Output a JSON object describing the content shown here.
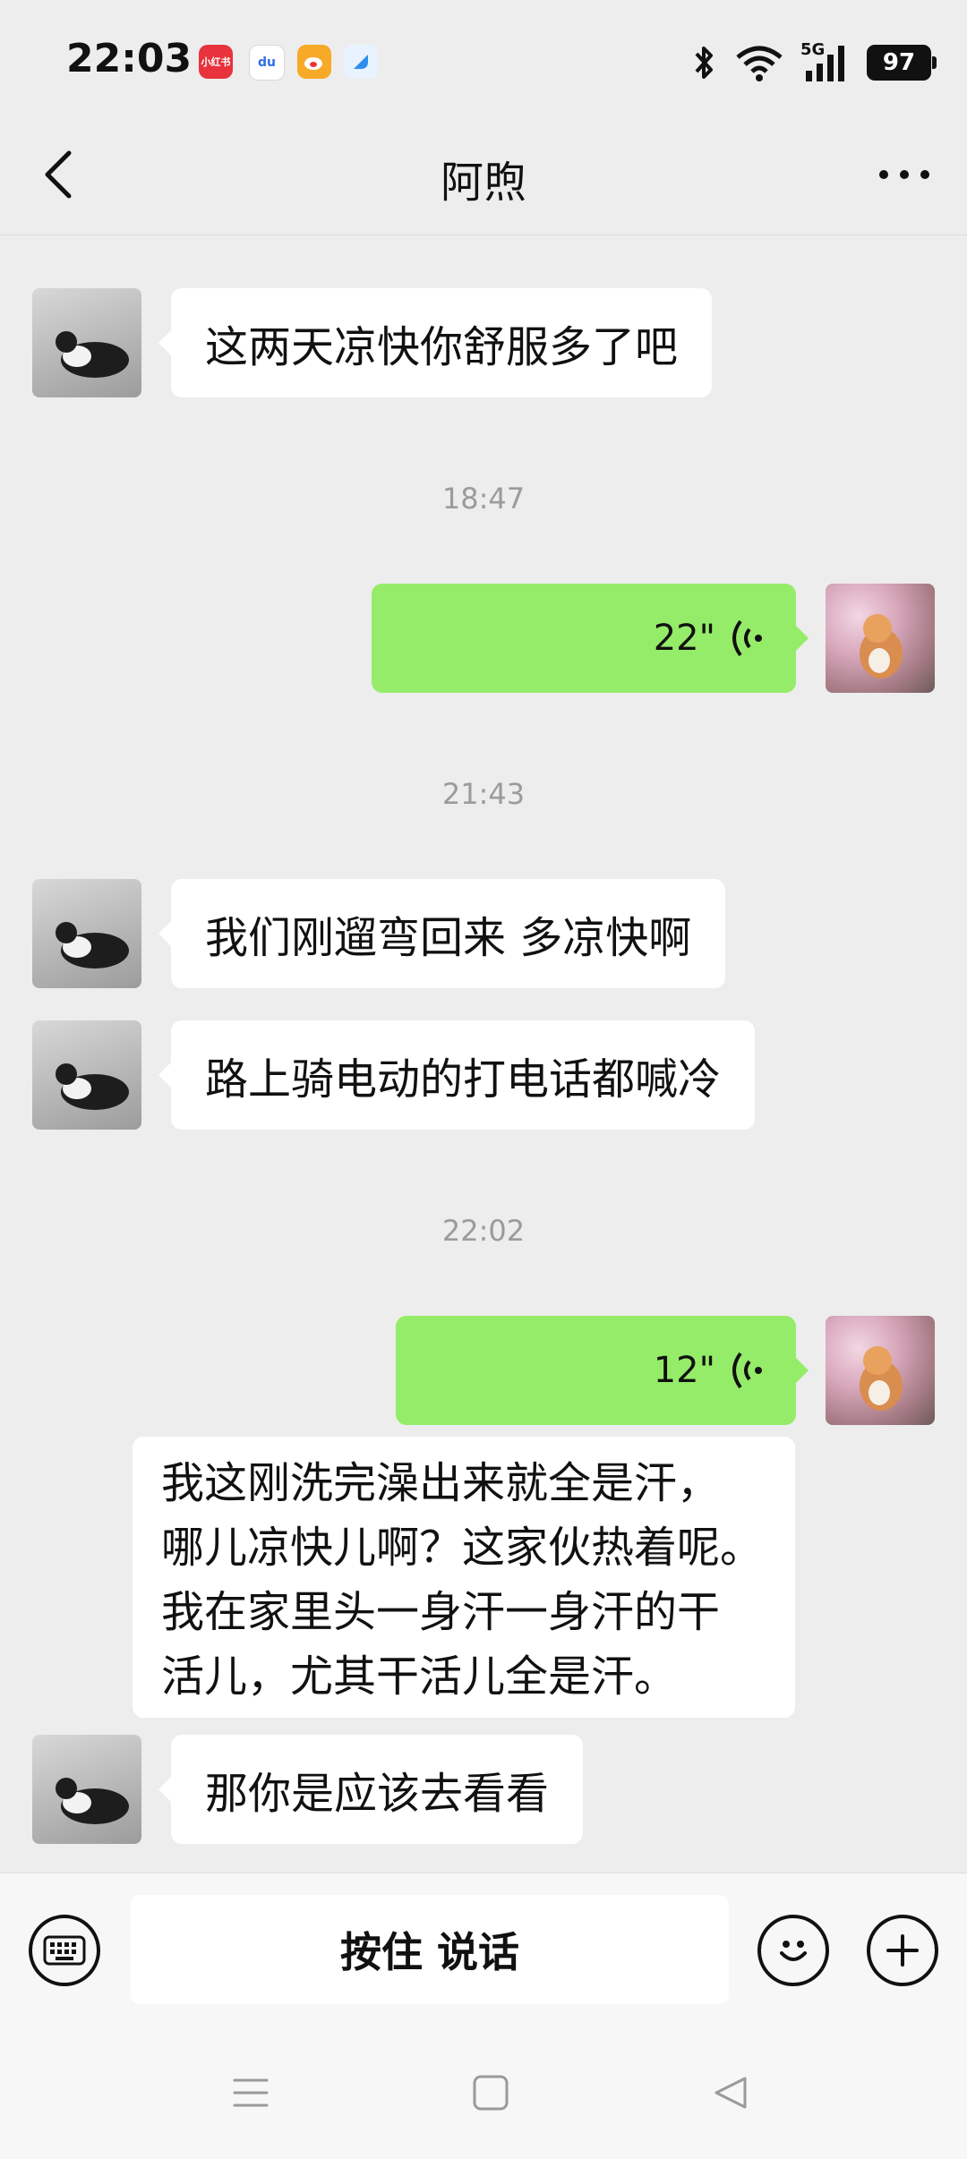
{
  "status_bar": {
    "time": "22:03",
    "apps": [
      {
        "name": "xiaohongshu-icon",
        "label": "小红书",
        "color": "#e8323c"
      },
      {
        "name": "baidu-icon",
        "label": "du",
        "color": "#2f6ee8"
      },
      {
        "name": "weibo-icon",
        "label": "",
        "color": "#f7a928"
      },
      {
        "name": "app-blue-icon",
        "label": "",
        "color": "#2e8ef0"
      }
    ],
    "network": "5G",
    "battery": "97"
  },
  "header": {
    "title": "阿煦"
  },
  "messages": {
    "m1": {
      "text": "这两天凉快你舒服多了吧"
    },
    "ts1": "18:47",
    "voice1": {
      "duration": "22\""
    },
    "ts2": "21:43",
    "m2": {
      "text": "我们刚遛弯回来 多凉快啊"
    },
    "m3": {
      "text": "路上骑电动的打电话都喊冷"
    },
    "ts3": "22:02",
    "voice2": {
      "duration": "12\""
    },
    "transcript": {
      "lines": [
        "我这刚洗完澡出来就全是汗，",
        "哪儿凉快儿啊？这家伙热着呢。",
        "我在家里头一身汗一身汗的干",
        "活儿，尤其干活儿全是汗。"
      ]
    },
    "m4": {
      "text": "那你是应该去看看"
    }
  },
  "input_bar": {
    "hold_to_talk": "按住 说话"
  },
  "colors": {
    "background": "#ededed",
    "bubble_sent": "#95ec69",
    "bubble_received": "#ffffff",
    "timestamp": "#9b9b9b"
  }
}
